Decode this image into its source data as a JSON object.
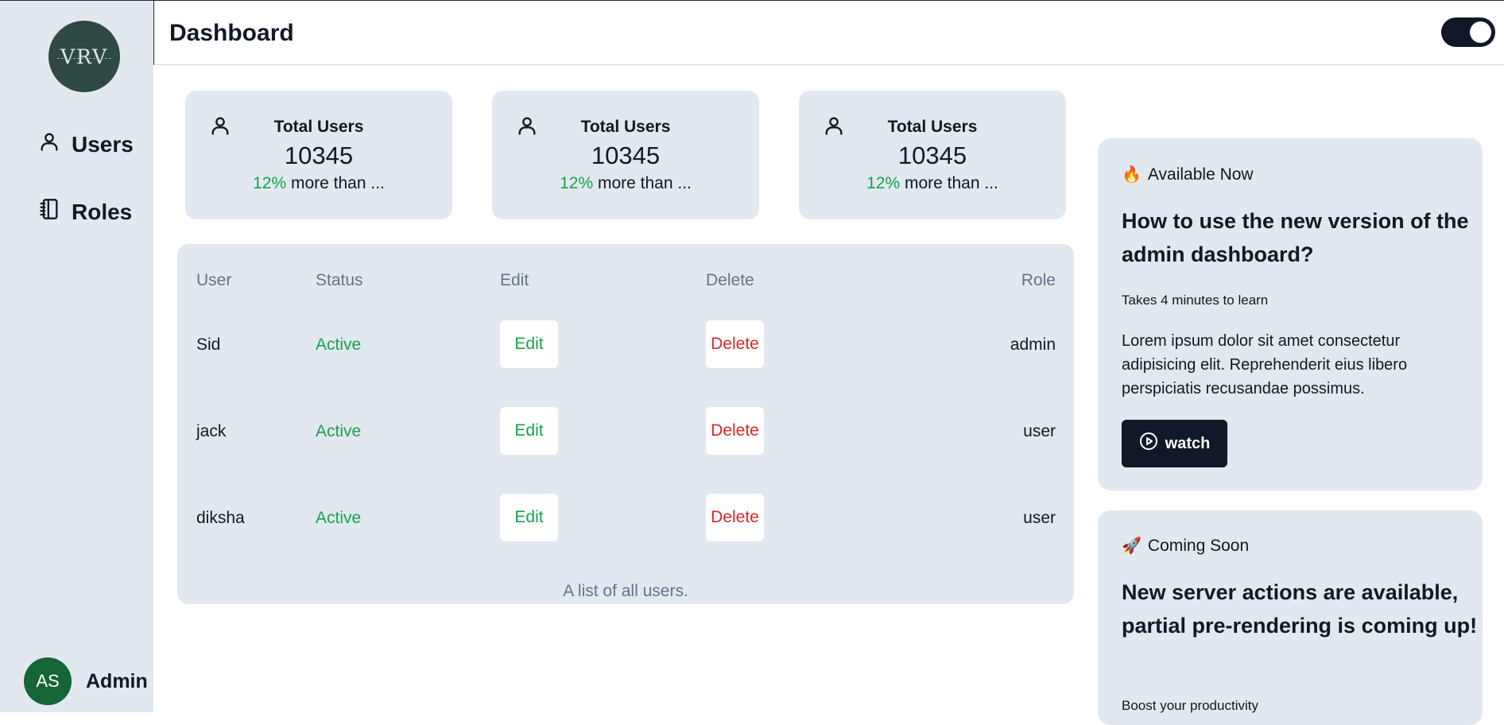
{
  "sidebar": {
    "logo_text": "VRV",
    "items": [
      {
        "label": "Users",
        "icon": "user-icon"
      },
      {
        "label": "Roles",
        "icon": "notebook-icon"
      }
    ],
    "user": {
      "initials": "AS",
      "name": "Admin"
    }
  },
  "header": {
    "title": "Dashboard",
    "toggle_state": "on"
  },
  "stats": [
    {
      "label": "Total Users",
      "value": "10345",
      "change": "12%",
      "change_text": " more than ..."
    },
    {
      "label": "Total Users",
      "value": "10345",
      "change": "12%",
      "change_text": " more than ..."
    },
    {
      "label": "Total Users",
      "value": "10345",
      "change": "12%",
      "change_text": " more than ..."
    }
  ],
  "table": {
    "headers": {
      "user": "User",
      "status": "Status",
      "edit": "Edit",
      "delete": "Delete",
      "role": "Role"
    },
    "rows": [
      {
        "user": "Sid",
        "status": "Active",
        "edit": "Edit",
        "delete": "Delete",
        "role": "admin"
      },
      {
        "user": "jack",
        "status": "Active",
        "edit": "Edit",
        "delete": "Delete",
        "role": "user"
      },
      {
        "user": "diksha",
        "status": "Active",
        "edit": "Edit",
        "delete": "Delete",
        "role": "user"
      }
    ],
    "caption": "A list of all users."
  },
  "promos": [
    {
      "tag": "Available Now",
      "tag_icon": "🔥",
      "title": "How to use the new version of the admin dashboard?",
      "meta": "Takes 4 minutes to learn",
      "body": "Lorem ipsum dolor sit amet consectetur adipisicing elit. Reprehenderit eius libero perspiciatis recusandae possimus.",
      "button": "watch"
    },
    {
      "tag": "Coming Soon",
      "tag_icon": "🚀",
      "title": "New server actions are available, partial pre-rendering is coming up!",
      "meta": "Boost your productivity"
    }
  ],
  "colors": {
    "panel": "#e2e8f0",
    "success": "#16a34a",
    "danger": "#dc2626",
    "dark": "#111827",
    "avatar": "#166534",
    "logo": "#2f4a44"
  }
}
